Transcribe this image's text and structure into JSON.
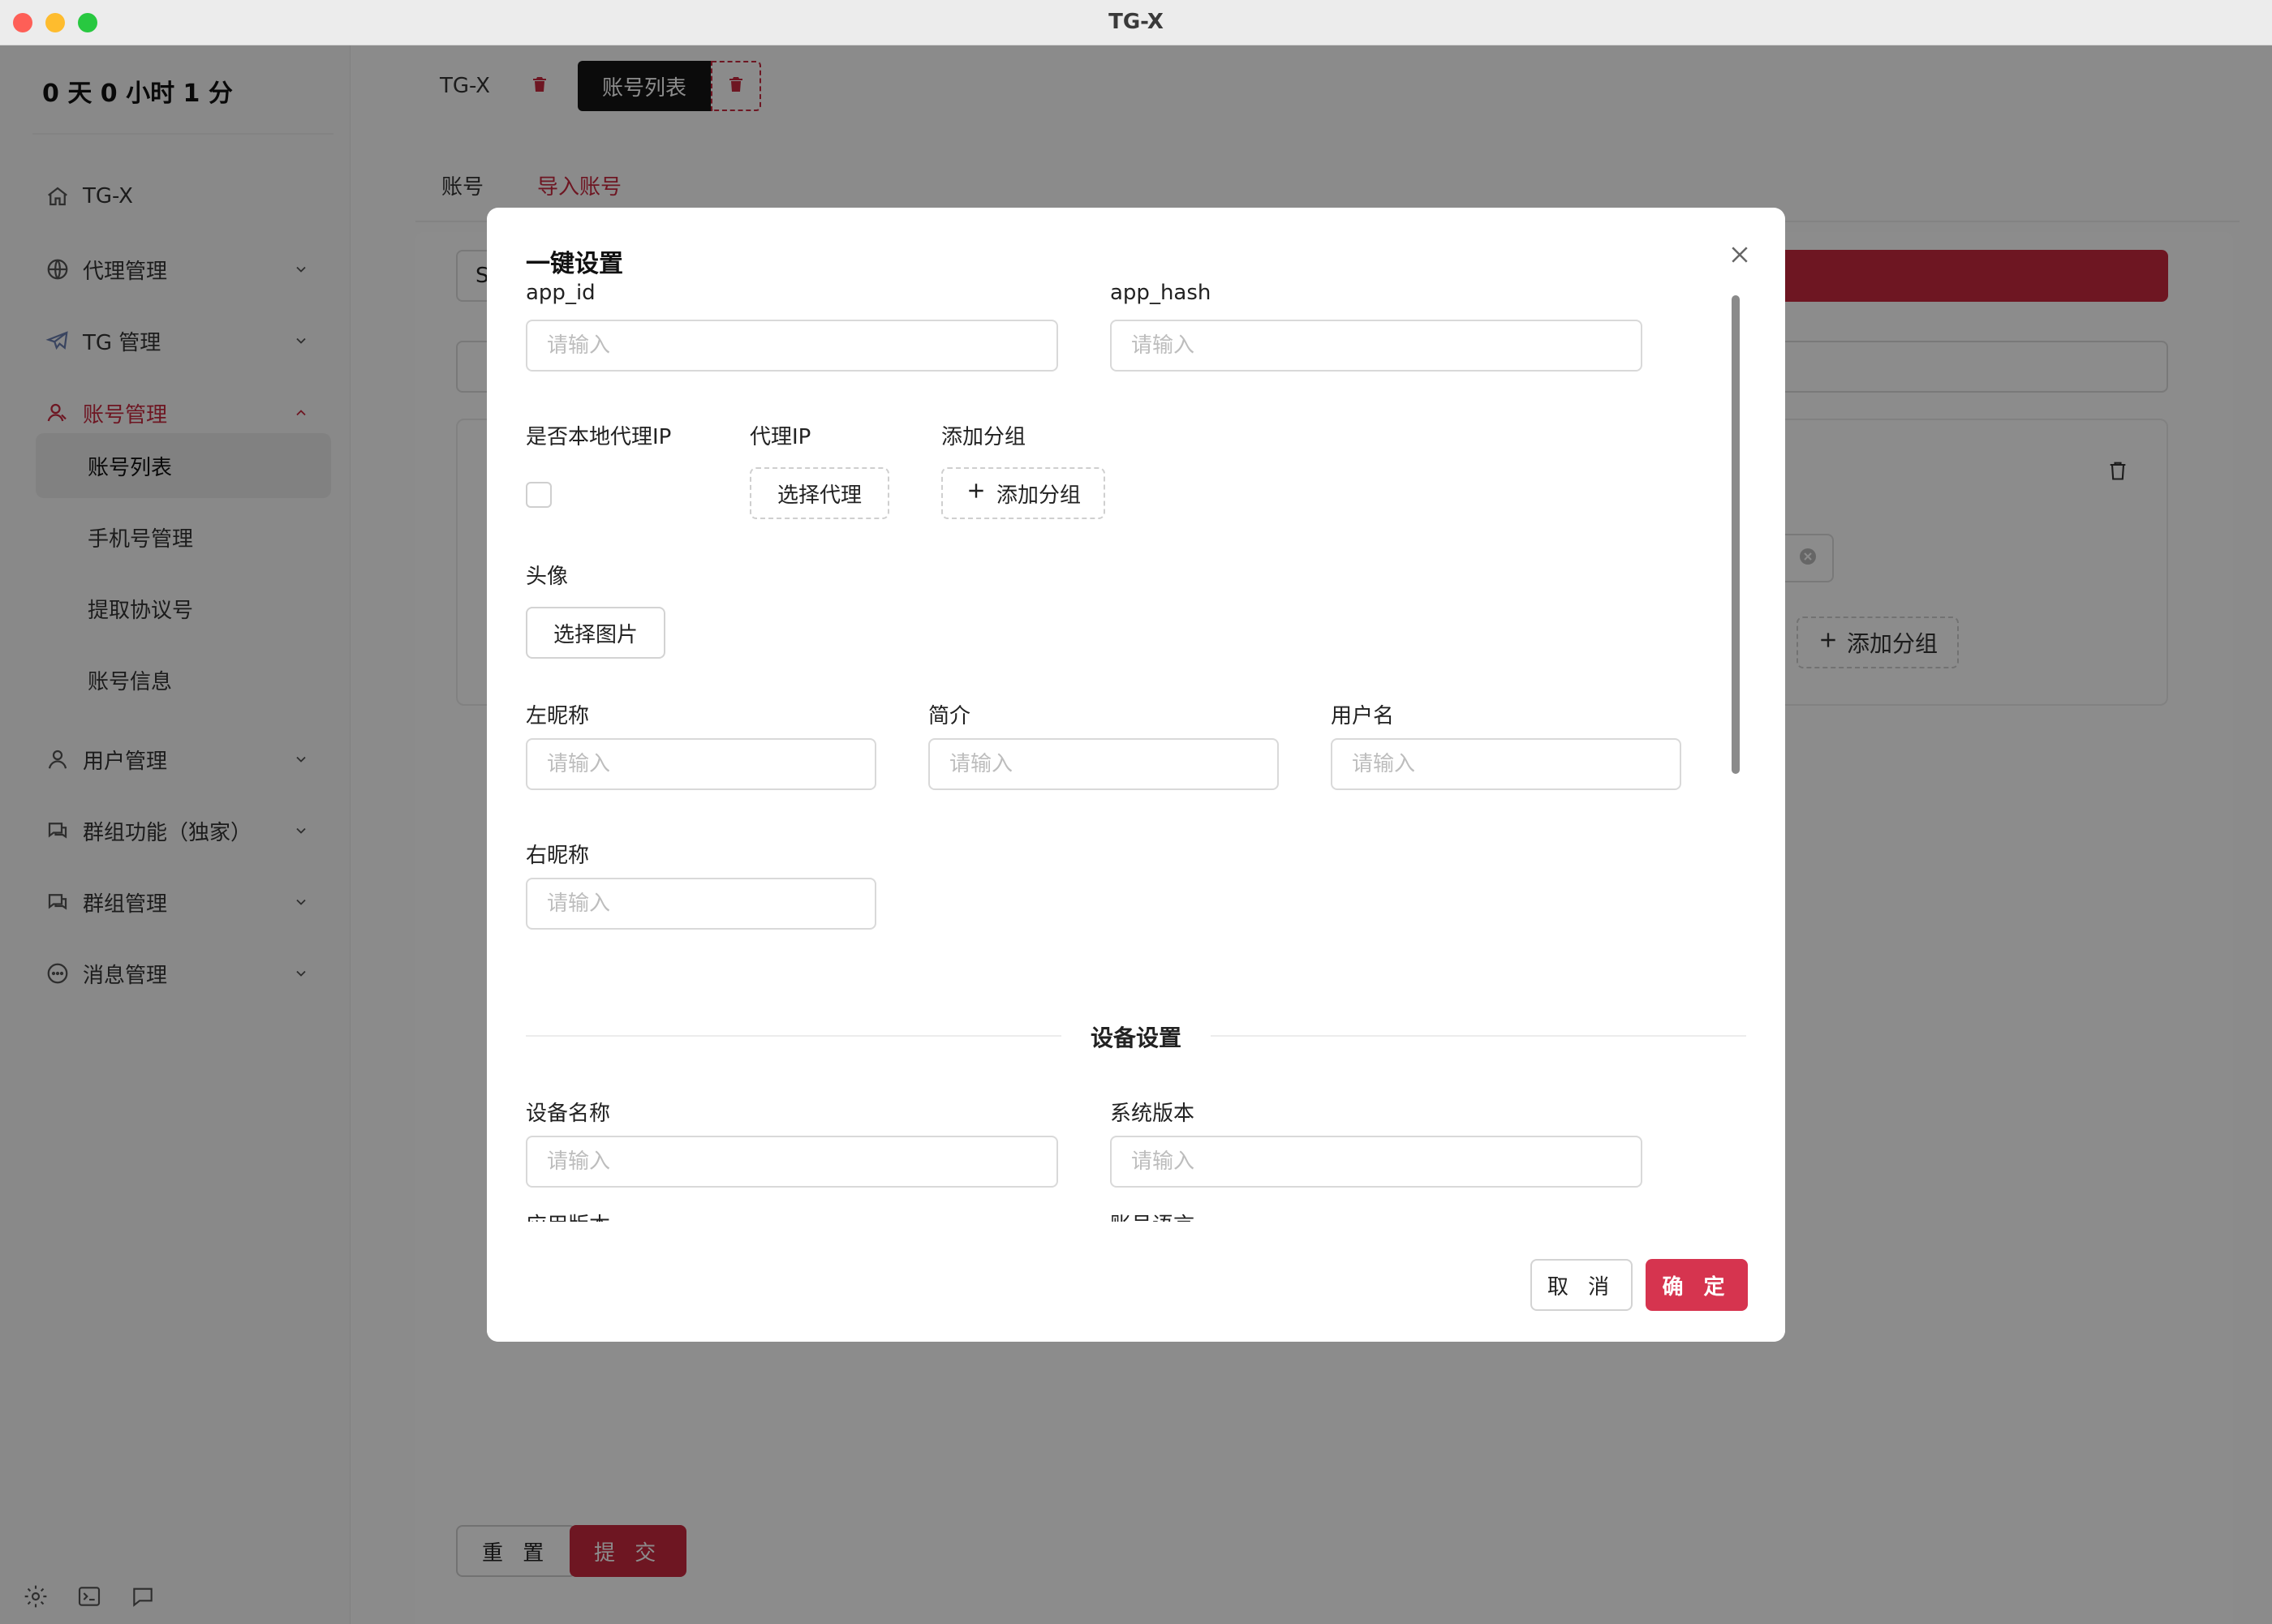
{
  "window": {
    "title": "TG-X"
  },
  "sidebar": {
    "uptime": "0 天 0 小时 1 分",
    "items": [
      {
        "label": "TG-X",
        "icon": "home-icon"
      },
      {
        "label": "代理管理",
        "icon": "globe-icon"
      },
      {
        "label": "TG 管理",
        "icon": "telegram-icon"
      },
      {
        "label": "账号管理",
        "icon": "account-icon"
      },
      {
        "label": "用户管理",
        "icon": "user-icon"
      },
      {
        "label": "群组功能（独家）",
        "icon": "chat-group-icon"
      },
      {
        "label": "群组管理",
        "icon": "chat-group-icon"
      },
      {
        "label": "消息管理",
        "icon": "message-icon"
      }
    ],
    "sub_items": [
      {
        "label": "账号列表"
      },
      {
        "label": "手机号管理"
      },
      {
        "label": "提取协议号"
      },
      {
        "label": "账号信息"
      }
    ]
  },
  "tabs": [
    {
      "label": "TG-X"
    },
    {
      "label": "账号列表"
    }
  ],
  "subtabs": [
    {
      "label": "账号"
    },
    {
      "label": "导入账号"
    }
  ],
  "background": {
    "input_stub": "S",
    "add_group_label": "添加分组",
    "reset_label": "重 置",
    "submit_label": "提 交"
  },
  "modal": {
    "title": "一键设置",
    "placeholder": "请输入",
    "fields": {
      "app_id": "app_id",
      "app_hash": "app_hash",
      "is_local_proxy": "是否本地代理IP",
      "proxy_ip": "代理IP",
      "add_group": "添加分组",
      "avatar": "头像",
      "left_nickname": "左昵称",
      "bio": "简介",
      "username": "用户名",
      "right_nickname": "右昵称",
      "device_name": "设备名称",
      "system_version": "系统版本",
      "app_version": "应用版本",
      "account_language": "账号语言"
    },
    "buttons": {
      "select_proxy": "选择代理",
      "add_group": "添加分组",
      "select_image": "选择图片",
      "cancel": "取 消",
      "ok": "确 定"
    },
    "device_section_title": "设备设置"
  },
  "colors": {
    "accent": "#c8293f",
    "ok_button": "#d6344f",
    "placeholder": "#bdbdbd"
  }
}
